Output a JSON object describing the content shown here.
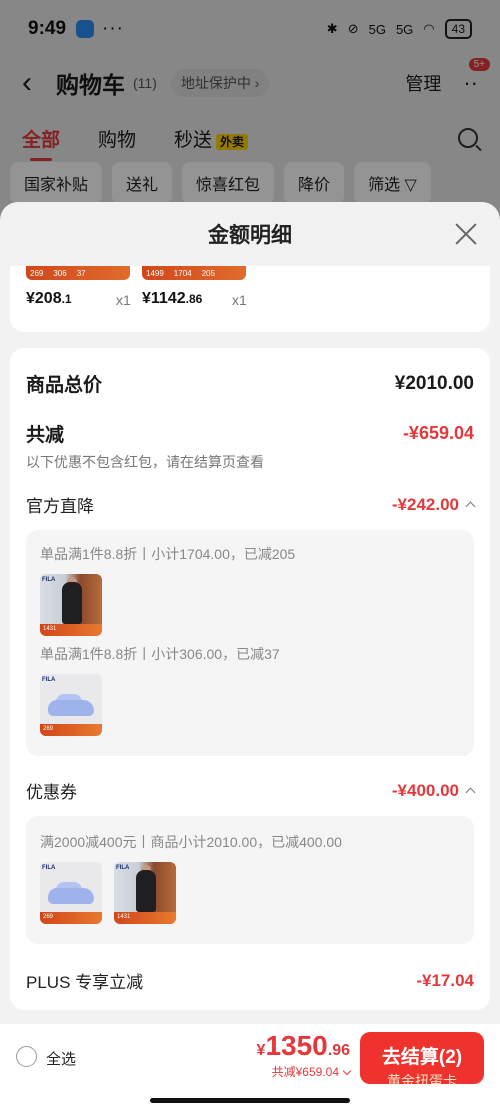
{
  "status_bar": {
    "time": "9:49",
    "dots": "···",
    "network": "5G",
    "network2": "5G",
    "battery": "43"
  },
  "nav": {
    "title": "购物车",
    "count": "(11)",
    "address": "地址保护中",
    "manage": "管理",
    "badge": "5+"
  },
  "tabs": [
    {
      "label": "全部"
    },
    {
      "label": "购物"
    },
    {
      "label": "秒送",
      "tag": "外卖"
    }
  ],
  "filters": [
    "国家补贴",
    "送礼",
    "惊喜红包",
    "降价",
    "筛选"
  ],
  "sheet": {
    "title": "金额明细"
  },
  "items": [
    {
      "price_int": "¥208",
      "price_dec": ".1",
      "qty": "x1",
      "strip": [
        "269",
        "306",
        "37"
      ]
    },
    {
      "price_int": "¥1142",
      "price_dec": ".86",
      "qty": "x1",
      "strip": [
        "1499",
        "1704",
        "205"
      ]
    }
  ],
  "summary": {
    "goods_total_label": "商品总价",
    "goods_total_value": "¥2010.00",
    "discount_label": "共减",
    "discount_value": "-¥659.04",
    "discount_note": "以下优惠不包含红包，请在结算页查看",
    "official": {
      "label": "官方直降",
      "value": "-¥242.00",
      "lines": [
        "单品满1件8.8折丨小计1704.00，已减205",
        "单品满1件8.8折丨小计306.00，已减37"
      ]
    },
    "coupon": {
      "label": "优惠券",
      "value": "-¥400.00",
      "line": "满2000减400元丨商品小计2010.00，已减400.00"
    },
    "plus": {
      "label": "PLUS 专享立减",
      "value": "-¥17.04"
    }
  },
  "product_tags": {
    "brand": "FILA",
    "coat_band": "1431",
    "slide_band": "269"
  },
  "bottom": {
    "select_all": "全选",
    "yen": "¥",
    "total_int": "1350",
    "total_dec": ".96",
    "saved": "共减¥659.04",
    "checkout": "去结算(2)",
    "checkout_sub": "黄金扭蛋卡"
  },
  "colors": {
    "accent": "#e4393c",
    "checkout_bg": "#f0322e",
    "band": "#d2461a"
  }
}
